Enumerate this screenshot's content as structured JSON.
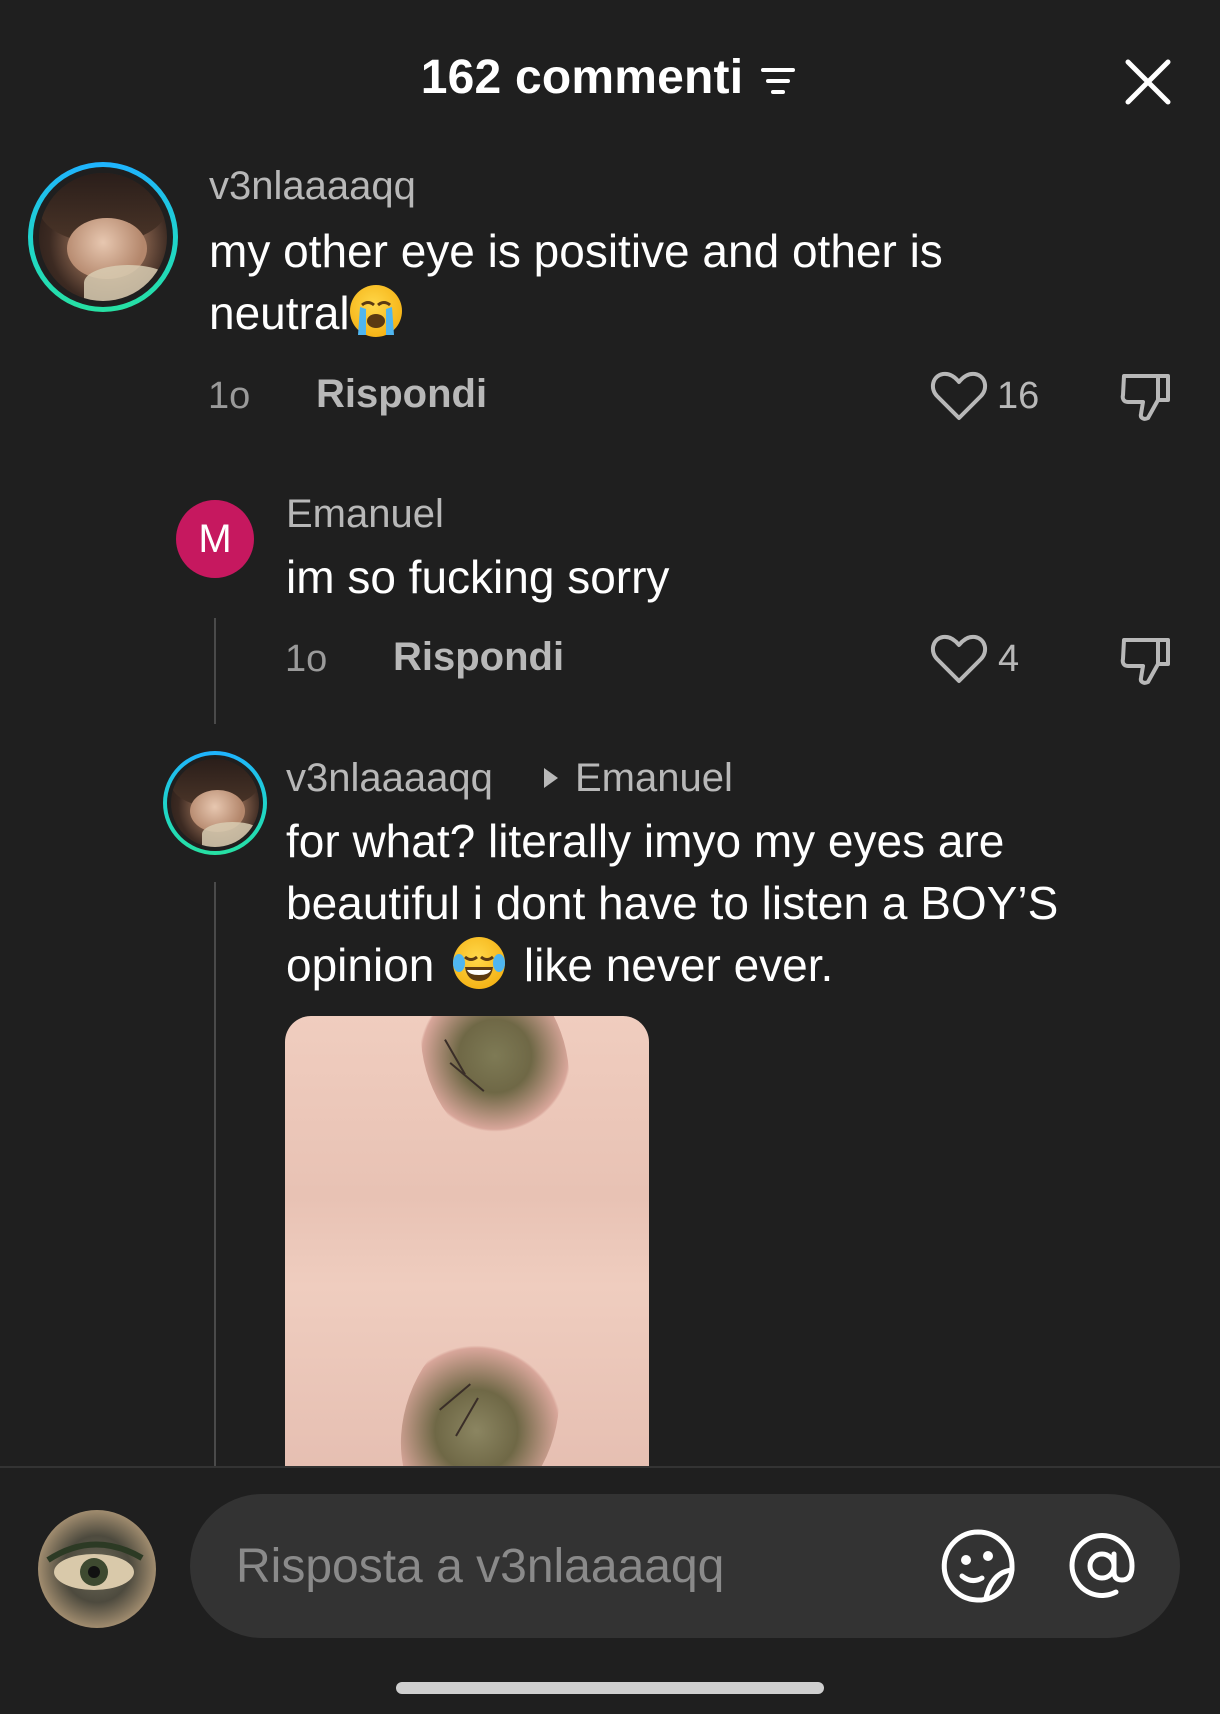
{
  "header": {
    "title": "162 commenti",
    "filter_icon": "filter-icon",
    "close_icon": "close-icon"
  },
  "comments": [
    {
      "username": "v3nlaaaaqq",
      "text_line1": "my other eye is positive and other is",
      "text_line2": "neutral",
      "emoji": "loudly-crying-face",
      "time": "1o",
      "reply_label": "Rispondi",
      "likes": "16"
    }
  ],
  "replies": [
    {
      "avatar_letter": "M",
      "username": "Emanuel",
      "text": "im so fucking sorry",
      "time": "1o",
      "reply_label": "Rispondi",
      "likes": "4"
    },
    {
      "username": "v3nlaaaaqq",
      "reply_to": "Emanuel",
      "text_line1": "for what? literally imyo my eyes are",
      "text_line2": "beautiful i dont have to listen a BOY’S",
      "text_line3a": "opinion",
      "text_line3b": "like never ever.",
      "emoji": "face-with-tears-of-joy",
      "attachment": "eye-photo"
    }
  ],
  "composer": {
    "placeholder": "Risposta a v3nlaaaaqq",
    "value": "",
    "emoji_icon": "sticker-emoji-icon",
    "mention_icon": "mention-icon"
  },
  "colors": {
    "background": "#1f1f1f",
    "text_primary": "#ffffff",
    "text_secondary": "#b8b8b8",
    "avatar_letter_bg": "#c6185f",
    "ring_gradient_start": "#1fb3ff",
    "ring_gradient_end": "#27e0a2",
    "input_bg": "#333333"
  }
}
